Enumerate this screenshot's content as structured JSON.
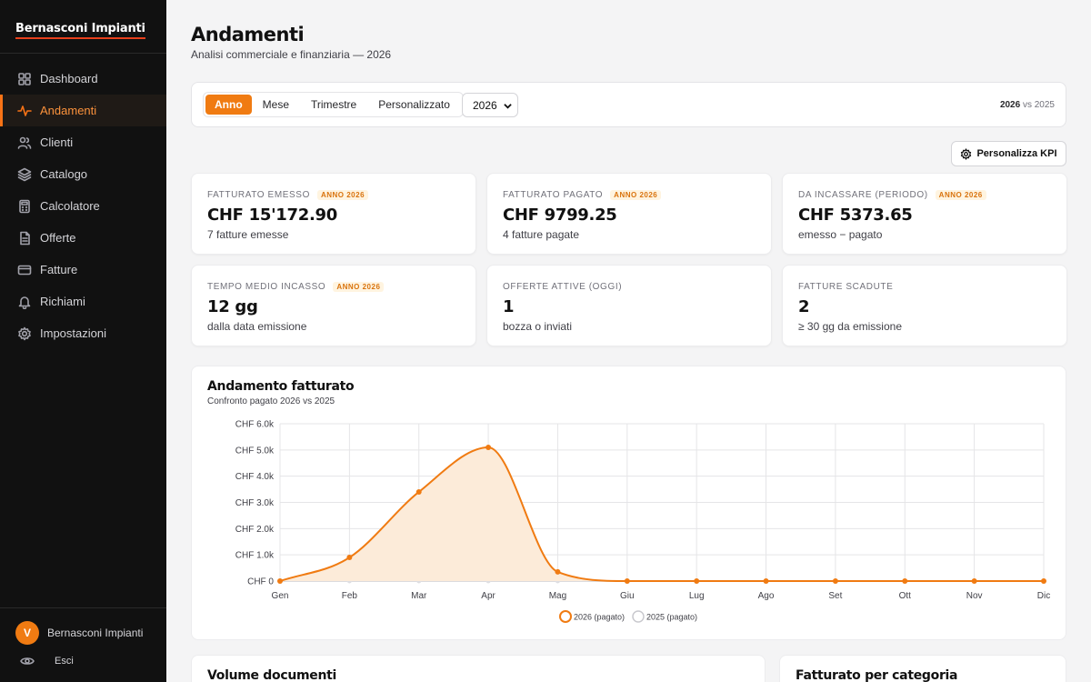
{
  "sidebar": {
    "brand": "Bernasconi Impianti",
    "items": [
      {
        "label": "Dashboard",
        "icon": "dashboard-icon"
      },
      {
        "label": "Andamenti",
        "icon": "activity-icon",
        "active": true
      },
      {
        "label": "Clienti",
        "icon": "users-icon"
      },
      {
        "label": "Catalogo",
        "icon": "layers-icon"
      },
      {
        "label": "Calcolatore",
        "icon": "calculator-icon"
      },
      {
        "label": "Offerte",
        "icon": "file-icon"
      },
      {
        "label": "Fatture",
        "icon": "credit-card-icon"
      },
      {
        "label": "Richiami",
        "icon": "bell-icon"
      },
      {
        "label": "Impostazioni",
        "icon": "gear-icon"
      }
    ],
    "user": {
      "initial": "V",
      "name": "Bernasconi Impianti"
    },
    "logout_label": "Esci"
  },
  "header": {
    "title": "Andamenti",
    "subtitle": "Analisi commerciale e finanziaria — 2026"
  },
  "filters": {
    "period_options": [
      "Anno",
      "Mese",
      "Trimestre",
      "Personalizzato"
    ],
    "active_period": "Anno",
    "year": "2026",
    "compare_current": "2026",
    "compare_word": "vs",
    "compare_previous": "2025"
  },
  "kpi_button_label": "Personalizza KPI",
  "kpis": [
    {
      "label": "Fatturato emesso",
      "badge": "ANNO 2026",
      "value": "CHF 15'172.90",
      "note": "7 fatture emesse"
    },
    {
      "label": "Fatturato pagato",
      "badge": "ANNO 2026",
      "value": "CHF 9799.25",
      "note": "4 fatture pagate"
    },
    {
      "label": "Da incassare (periodo)",
      "badge": "ANNO 2026",
      "value": "CHF 5373.65",
      "note": "emesso − pagato"
    },
    {
      "label": "Tempo medio incasso",
      "badge": "ANNO 2026",
      "value": "12 gg",
      "note": "dalla data emissione"
    },
    {
      "label": "Offerte attive (oggi)",
      "badge": "",
      "value": "1",
      "note": "bozza o inviati"
    },
    {
      "label": "Fatture scadute",
      "badge": "",
      "value": "2",
      "note": "≥ 30 gg da emissione"
    }
  ],
  "chart": {
    "title": "Andamento fatturato",
    "subtitle": "Confronto pagato 2026 vs 2025"
  },
  "chart_data": {
    "type": "line",
    "categories": [
      "Gen",
      "Feb",
      "Mar",
      "Apr",
      "Mag",
      "Giu",
      "Lug",
      "Ago",
      "Set",
      "Ott",
      "Nov",
      "Dic"
    ],
    "series": [
      {
        "name": "2026 (pagato)",
        "values": [
          0,
          900,
          3400,
          5100,
          350,
          0,
          0,
          0,
          0,
          0,
          0,
          0
        ],
        "color": "#f07b12"
      },
      {
        "name": "2025 (pagato)",
        "values": [
          0,
          0,
          0,
          0,
          0,
          0,
          0,
          0,
          0,
          0,
          0,
          0
        ],
        "color": "#cfcfd4"
      }
    ],
    "ylim": [
      0,
      6000
    ],
    "yticks": [
      "CHF 0",
      "CHF 1.0k",
      "CHF 2.0k",
      "CHF 3.0k",
      "CHF 4.0k",
      "CHF 5.0k",
      "CHF 6.0k"
    ],
    "grid": true,
    "legend": "bottom-center"
  },
  "bottom_cards": [
    {
      "title": "Volume documenti"
    },
    {
      "title": "Fatturato per categoria"
    }
  ],
  "colors": {
    "accent": "#f07b12",
    "sidebar_bg": "#111111"
  }
}
